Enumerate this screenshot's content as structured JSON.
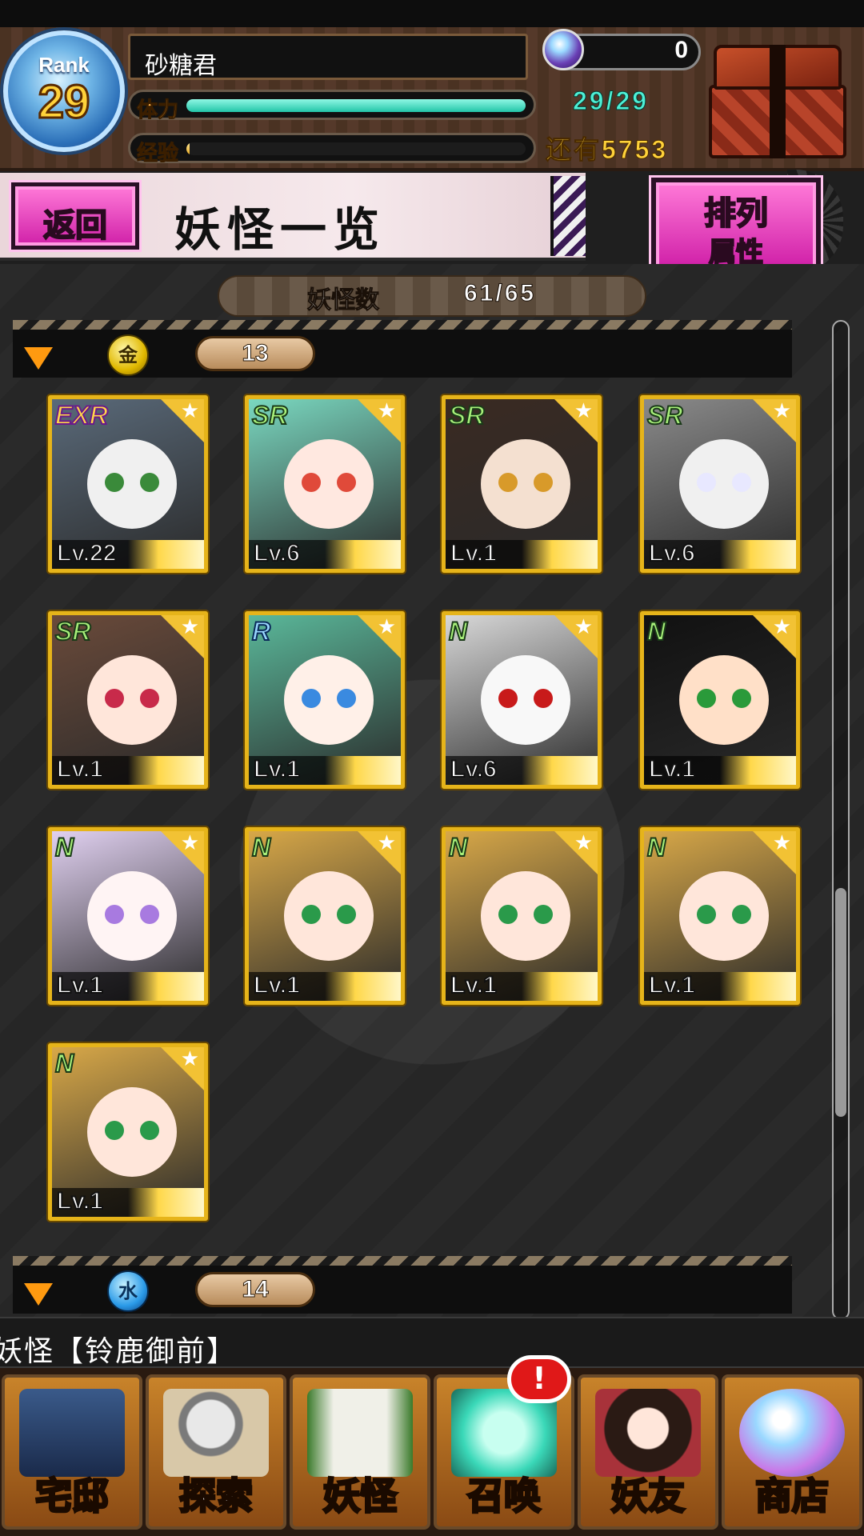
{
  "player": {
    "rank_label": "Rank",
    "rank": "29",
    "name": "砂糖君",
    "orb_count": "0",
    "stamina_label": "体力",
    "stamina_value": "29/29",
    "stamina_fraction": 1.0,
    "exp_label": "经验",
    "exp_value": "还有5753",
    "exp_fraction": 0.01
  },
  "title_bar": {
    "back_label": "返回",
    "title": "妖怪一览",
    "sort_top": "排列",
    "sort_bottom": "属性"
  },
  "yokai_count": {
    "label": "妖怪数",
    "value": "61/65"
  },
  "groups": [
    {
      "element": "金",
      "element_icon": "gold-element-icon",
      "count": "13",
      "cards": [
        {
          "rarity": "EXR",
          "level": "Lv.22"
        },
        {
          "rarity": "SR",
          "level": "Lv.6"
        },
        {
          "rarity": "SR",
          "level": "Lv.1"
        },
        {
          "rarity": "SR",
          "level": "Lv.6"
        },
        {
          "rarity": "SR",
          "level": "Lv.1"
        },
        {
          "rarity": "R",
          "level": "Lv.1"
        },
        {
          "rarity": "N",
          "level": "Lv.6"
        },
        {
          "rarity": "N",
          "level": "Lv.1"
        },
        {
          "rarity": "N",
          "level": "Lv.1"
        },
        {
          "rarity": "N",
          "level": "Lv.1"
        },
        {
          "rarity": "N",
          "level": "Lv.1"
        },
        {
          "rarity": "N",
          "level": "Lv.1"
        },
        {
          "rarity": "N",
          "level": "Lv.1"
        }
      ]
    },
    {
      "element": "水",
      "element_icon": "water-element-icon",
      "count": "14",
      "cards": []
    }
  ],
  "ticker": "妖怪【铃鹿御前】",
  "nav": [
    {
      "label": "宅邸",
      "icon": "mansion-icon"
    },
    {
      "label": "探索",
      "icon": "magnifier-map-icon"
    },
    {
      "label": "妖怪",
      "icon": "scroll-icon"
    },
    {
      "label": "召唤",
      "icon": "summon-star-icon",
      "badge": "!"
    },
    {
      "label": "妖友",
      "icon": "fox-girl-icon"
    },
    {
      "label": "商店",
      "icon": "crystal-orb-icon"
    }
  ],
  "colors": {
    "card_border": "#e6b41a",
    "button_pink": "#d020a8",
    "stamina_teal": "#22c5a8",
    "exp_gold": "#ffd23a"
  }
}
